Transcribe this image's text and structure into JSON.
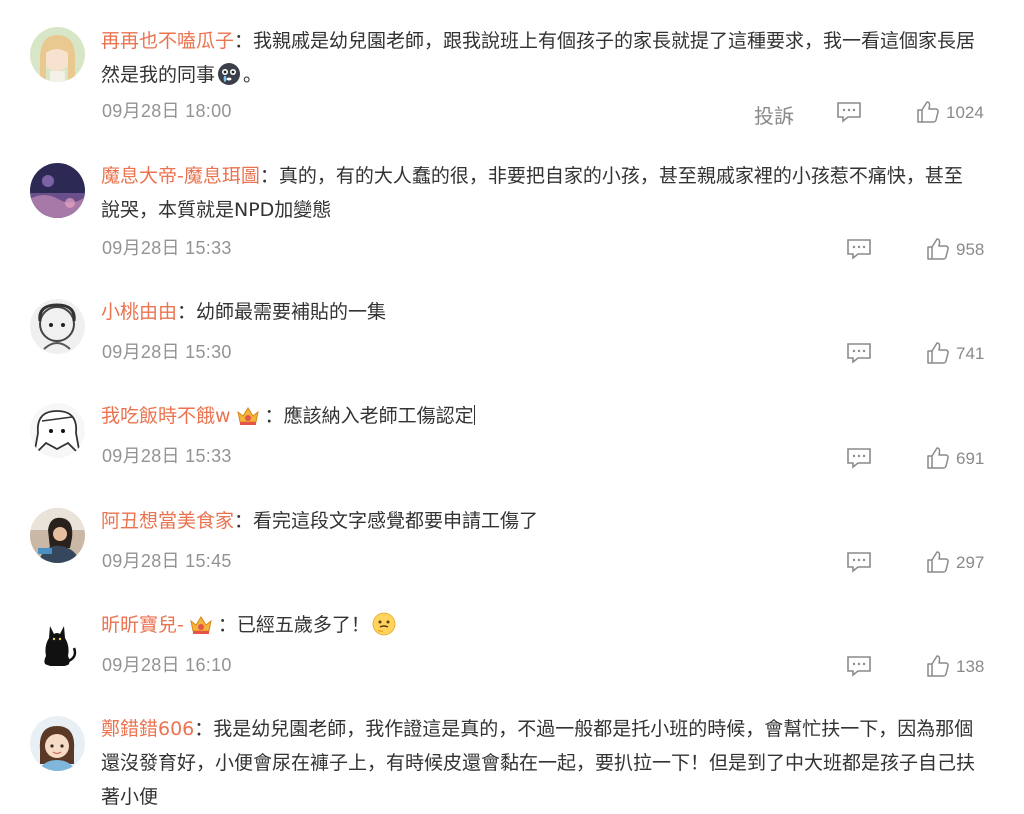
{
  "comments": [
    {
      "username": "再再也不嗑瓜子",
      "separator": "：",
      "content_1": "我親戚是幼兒園老師，跟我說班上有個孩子的家長就提了這種要求，我一看這個家長居",
      "content_2": "然是我的同事",
      "content_emoji": "crying-face-emoji",
      "content_tail": "。",
      "time": "09月28日 18:00",
      "report": "投訴",
      "likes": "1024",
      "avatar": "anime-girl-avatar"
    },
    {
      "username": "魔息大帝-魔息珥圖",
      "separator": "：",
      "content_1": "真的，有的大人蠢的很，非要把自家的小孩，甚至親戚家裡的小孩惹不痛快，甚至",
      "content_2": "說哭，本質就是NPD加變態",
      "time": "09月28日 15:33",
      "likes": "958",
      "avatar": "purple-scenery-avatar"
    },
    {
      "username": "小桃由由",
      "separator": "：",
      "content_1": "幼師最需要補貼的一集",
      "time": "09月28日 15:30",
      "likes": "741",
      "avatar": "sketch-character-avatar"
    },
    {
      "username": "我吃飯時不餓w",
      "badge": "crown-badge-icon",
      "separator": "：",
      "content_1": "應該納入老師工傷認定",
      "time": "09月28日 15:33",
      "likes": "691",
      "avatar": "manga-girl-avatar"
    },
    {
      "username": "阿丑想當美食家",
      "separator": "：",
      "content_1": "看完這段文字感覺都要申請工傷了",
      "time": "09月28日 15:45",
      "likes": "297",
      "avatar": "woman-photo-avatar"
    },
    {
      "username": "昕昕寶兒-",
      "badge": "crown-badge-icon",
      "separator": "：",
      "content_1": "已經五歲多了！",
      "content_emoji": "thinking-face-emoji",
      "time": "09月28日 16:10",
      "likes": "138",
      "avatar": "black-cat-avatar"
    },
    {
      "username": "鄭錯錯606",
      "separator": "：",
      "content_1": "我是幼兒園老師，我作證這是真的，不過一般都是托小班的時候，會幫忙扶一下，因為那個",
      "content_2": "還沒發育好，小便會尿在褲子上，有時候皮還會黏在一起，要扒拉一下！但是到了中大班都是孩子自己扶",
      "content_3": "著小便",
      "avatar": "cartoon-girl-avatar"
    }
  ],
  "colors": {
    "username": "#eb7350",
    "meta": "#939393"
  }
}
